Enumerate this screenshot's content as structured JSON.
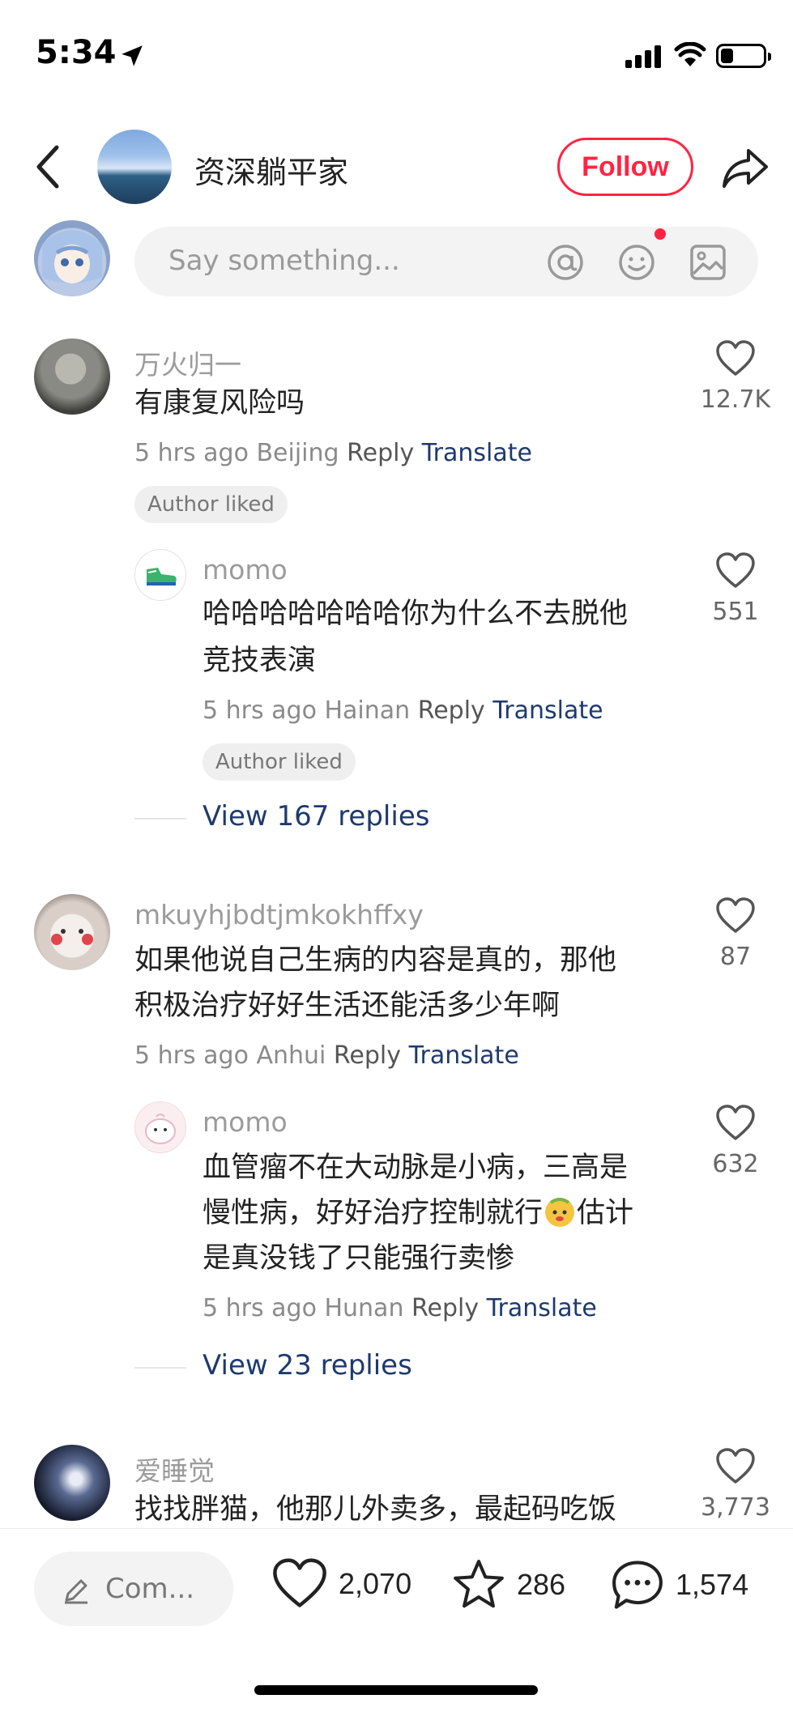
{
  "status": {
    "time": "5:34",
    "battery_level": 0.3
  },
  "header": {
    "author": "资深躺平家",
    "follow_label": "Follow"
  },
  "input": {
    "placeholder": "Say something..."
  },
  "comments": [
    {
      "user": "万火归一",
      "text": "有康复风险吗",
      "time": "5 hrs ago",
      "location": "Beijing",
      "reply": "Reply",
      "translate": "Translate",
      "badge": "Author liked",
      "likes": "12.7K",
      "replies": [
        {
          "user": "momo",
          "text_line1": "哈哈哈哈哈哈哈你为什么不去脱他",
          "text_line2": "竞技表演",
          "time": "5 hrs ago",
          "location": "Hainan",
          "reply": "Reply",
          "translate": "Translate",
          "badge": "Author liked",
          "likes": "551"
        }
      ],
      "view_replies": "View 167 replies"
    },
    {
      "user": "mkuyhjbdtjmkokhffxy",
      "text_line1": "如果他说自己生病的内容是真的，那他",
      "text_line2": "积极治疗好好生活还能活多少年啊",
      "time": "5 hrs ago",
      "location": "Anhui",
      "reply": "Reply",
      "translate": "Translate",
      "likes": "87",
      "replies": [
        {
          "user": "momo",
          "text_line1": "血管瘤不在大动脉是小病，三高是",
          "text_line2a": "慢性病，好好治疗控制就行",
          "text_line2b": "估计",
          "text_line3": "是真没钱了只能强行卖惨",
          "time": "5 hrs ago",
          "location": "Hunan",
          "reply": "Reply",
          "translate": "Translate",
          "likes": "632"
        }
      ],
      "view_replies": "View 23 replies"
    },
    {
      "user": "爱睡觉",
      "text": "找找胖猫，他那儿外卖多，最起码吃饭",
      "likes": "3,773"
    }
  ],
  "bottom_bar": {
    "comment_label": "Com...",
    "likes": "2,070",
    "favorites": "286",
    "comments": "1,574"
  }
}
